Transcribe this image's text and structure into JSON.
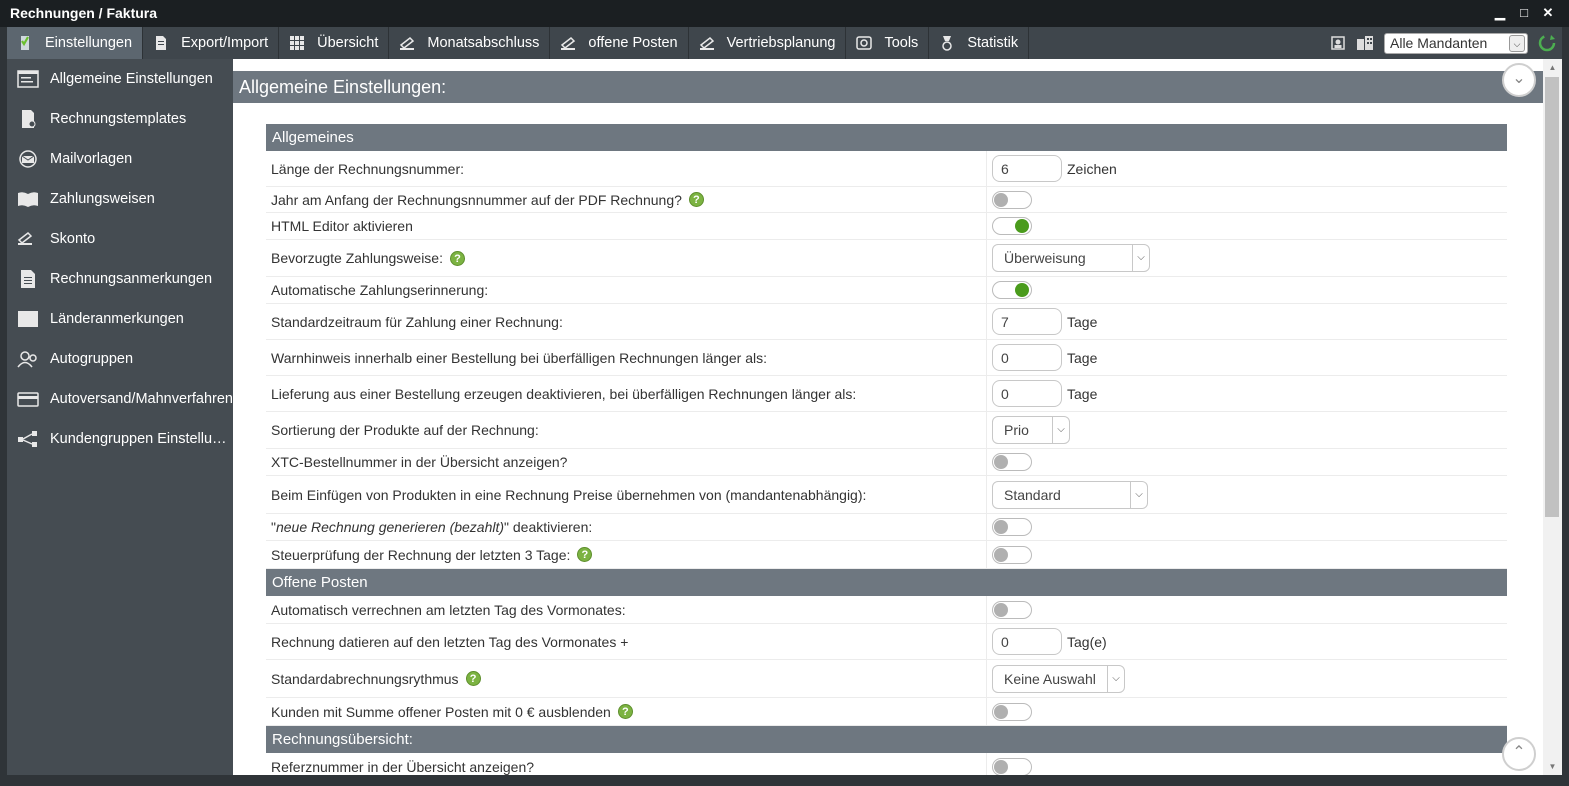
{
  "window": {
    "title": "Rechnungen / Faktura",
    "minimize": "▁",
    "maximize": "□",
    "close": "✕"
  },
  "toolbar": {
    "items": [
      {
        "label": "Einstellungen",
        "icon": "checklist-icon",
        "active": true
      },
      {
        "label": "Export/Import",
        "icon": "document-icon"
      },
      {
        "label": "Übersicht",
        "icon": "grid-icon"
      },
      {
        "label": "Monatsabschluss",
        "icon": "money-icon"
      },
      {
        "label": "offene Posten",
        "icon": "money-icon"
      },
      {
        "label": "Vertriebsplanung",
        "icon": "money-icon"
      },
      {
        "label": "Tools",
        "icon": "disk-icon"
      },
      {
        "label": "Statistik",
        "icon": "medal-icon"
      }
    ],
    "mandant_select": "Alle Mandanten"
  },
  "sidebar": {
    "items": [
      {
        "label": "Allgemeine Einstellungen",
        "icon": "window-icon"
      },
      {
        "label": "Rechnungstemplates",
        "icon": "template-icon"
      },
      {
        "label": "Mailvorlagen",
        "icon": "mail-icon"
      },
      {
        "label": "Zahlungsweisen",
        "icon": "book-icon"
      },
      {
        "label": "Skonto",
        "icon": "money-icon"
      },
      {
        "label": "Rechnungsanmerkungen",
        "icon": "note-icon"
      },
      {
        "label": "Länderanmerkungen",
        "icon": "flag-icon"
      },
      {
        "label": "Autogruppen",
        "icon": "users-icon"
      },
      {
        "label": "Autoversand/Mahnverfahren",
        "icon": "card-icon"
      },
      {
        "label": "Kundengruppen Einstellun…",
        "icon": "share-icon"
      }
    ]
  },
  "main": {
    "title": "Allgemeine Einstellungen:",
    "sections": [
      {
        "title": "Allgemeines",
        "rows": [
          {
            "label": "Länge der Rechnungsnummer:",
            "type": "input",
            "value": "6",
            "unit": "Zeichen"
          },
          {
            "label": "Jahr am Anfang der Rechnungsnnummer auf der PDF Rechnung?",
            "help": true,
            "type": "toggle",
            "on": false
          },
          {
            "label": "HTML Editor aktivieren",
            "type": "toggle",
            "on": true
          },
          {
            "label": "Bevorzugte Zahlungsweise:",
            "help": true,
            "type": "select",
            "value": "Überweisung",
            "width": 158
          },
          {
            "label": "Automatische Zahlungserinnerung:",
            "type": "toggle",
            "on": true
          },
          {
            "label": "Standardzeitraum für Zahlung einer Rechnung:",
            "type": "input",
            "value": "7",
            "unit": "Tage"
          },
          {
            "label": "Warnhinweis innerhalb einer Bestellung bei überfälligen Rechnungen länger als:",
            "type": "input",
            "value": "0",
            "unit": "Tage"
          },
          {
            "label": "Lieferung aus einer Bestellung erzeugen deaktivieren, bei überfälligen Rechnungen länger als:",
            "type": "input",
            "value": "0",
            "unit": "Tage"
          },
          {
            "label": "Sortierung der Produkte auf der Rechnung:",
            "type": "select",
            "value": "Prio",
            "width": 78
          },
          {
            "label": "XTC-Bestellnummer in der Übersicht anzeigen?",
            "type": "toggle",
            "on": false
          },
          {
            "label": "Beim Einfügen von Produkten in eine Rechnung Preise übernehmen von (mandantenabhängig):",
            "type": "select",
            "value": "Standard",
            "width": 156
          },
          {
            "label_parts": [
              "\"",
              "neue Rechnung generieren (bezahlt)",
              "\" deaktivieren:"
            ],
            "type": "toggle",
            "on": false
          },
          {
            "label": "Steuerprüfung der Rechnung der letzten 3 Tage:",
            "help": true,
            "type": "toggle",
            "on": false
          }
        ]
      },
      {
        "title": "Offene Posten",
        "rows": [
          {
            "label": "Automatisch verrechnen am letzten Tag des Vormonates:",
            "type": "toggle",
            "on": false
          },
          {
            "label": "Rechnung datieren auf den letzten Tag des Vormonates +",
            "type": "input",
            "value": "0",
            "unit": "Tag(e)"
          },
          {
            "label": "Standardabrechnungsrythmus",
            "help": true,
            "type": "select",
            "value": "Keine Auswahl",
            "width": 133
          },
          {
            "label": "Kunden mit Summe offener Posten mit 0 € ausblenden",
            "help": true,
            "type": "toggle",
            "on": false
          }
        ]
      },
      {
        "title": "Rechnungsübersicht:",
        "rows": [
          {
            "label": "Referznummer in der Übersicht anzeigen?",
            "type": "toggle",
            "on": false
          }
        ]
      }
    ]
  },
  "colors": {
    "accent_green": "#4a9b1c",
    "header_gray": "#6e7780",
    "sidebar_bg": "#454c52",
    "toolbar_bg": "#3f464c"
  }
}
